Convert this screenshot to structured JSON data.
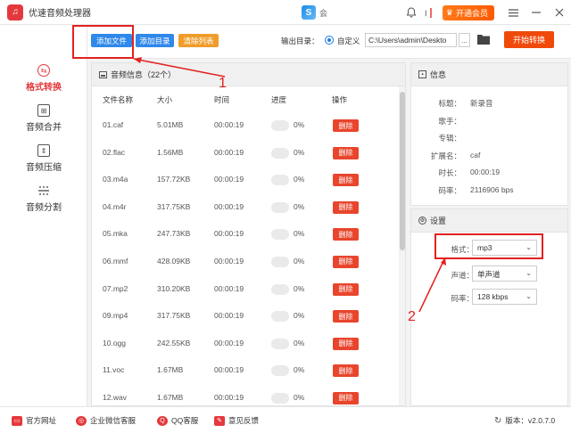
{
  "app": {
    "title": "优速音频处理器",
    "logo_glyph": "♫"
  },
  "titlebar": {
    "mid_text": "会",
    "vip_label": "开通会员"
  },
  "toolbar": {
    "add_file": "添加文件",
    "add_dir": "添加目录",
    "clear_list": "清除列表",
    "output_label": "输出目录：",
    "custom_label": "自定义",
    "output_path": "C:\\Users\\admin\\Deskto",
    "path_more": "...",
    "start": "开始转换"
  },
  "sidebar": {
    "items": [
      {
        "label": "格式转换",
        "active": true
      },
      {
        "label": "音频合并",
        "active": false
      },
      {
        "label": "音频压缩",
        "active": false
      },
      {
        "label": "音频分割",
        "active": false
      }
    ]
  },
  "list": {
    "header": "音频信息（22个）",
    "columns": {
      "name": "文件名称",
      "size": "大小",
      "time": "时间",
      "progress": "进度",
      "action": "操作"
    },
    "delete_label": "删除",
    "rows": [
      {
        "name": "01.caf",
        "size": "5.01MB",
        "time": "00:00:19",
        "progress": "0%"
      },
      {
        "name": "02.flac",
        "size": "1.56MB",
        "time": "00:00:19",
        "progress": "0%"
      },
      {
        "name": "03.m4a",
        "size": "157.72KB",
        "time": "00:00:19",
        "progress": "0%"
      },
      {
        "name": "04.m4r",
        "size": "317.75KB",
        "time": "00:00:19",
        "progress": "0%"
      },
      {
        "name": "05.mka",
        "size": "247.73KB",
        "time": "00:00:19",
        "progress": "0%"
      },
      {
        "name": "06.mmf",
        "size": "428.09KB",
        "time": "00:00:19",
        "progress": "0%"
      },
      {
        "name": "07.mp2",
        "size": "310.20KB",
        "time": "00:00:19",
        "progress": "0%"
      },
      {
        "name": "09.mp4",
        "size": "317.75KB",
        "time": "00:00:19",
        "progress": "0%"
      },
      {
        "name": "10.ogg",
        "size": "242.55KB",
        "time": "00:00:19",
        "progress": "0%"
      },
      {
        "name": "11.voc",
        "size": "1.67MB",
        "time": "00:00:19",
        "progress": "0%"
      },
      {
        "name": "12.wav",
        "size": "1.67MB",
        "time": "00:00:19",
        "progress": "0%"
      }
    ]
  },
  "info": {
    "header": "信息",
    "fields": [
      {
        "label": "标题：",
        "value": "新录音"
      },
      {
        "label": "歌手：",
        "value": ""
      },
      {
        "label": "专辑：",
        "value": ""
      },
      {
        "label": "扩展名：",
        "value": "caf"
      },
      {
        "label": "时长：",
        "value": "00:00:19"
      },
      {
        "label": "码率：",
        "value": "2116906 bps"
      }
    ]
  },
  "settings": {
    "header": "设置",
    "format_label": "格式：",
    "format_value": "mp3",
    "channel_label": "声道：",
    "channel_value": "单声道",
    "bitrate_label": "码率：",
    "bitrate_value": "128 kbps"
  },
  "annotations": {
    "one": "1",
    "two": "2"
  },
  "footer": {
    "website": "官方网址",
    "wechat": "企业微信客服",
    "qq": "QQ客服",
    "feedback": "意见反馈",
    "version": "版本：v2.0.7.0"
  },
  "colors": {
    "accent_red": "#e4393c",
    "button_blue": "#2f88ea",
    "button_orange": "#f09c2a",
    "start_orange": "#f04a0a",
    "delete_red": "#e8452c",
    "annotation_red": "#e42020"
  }
}
